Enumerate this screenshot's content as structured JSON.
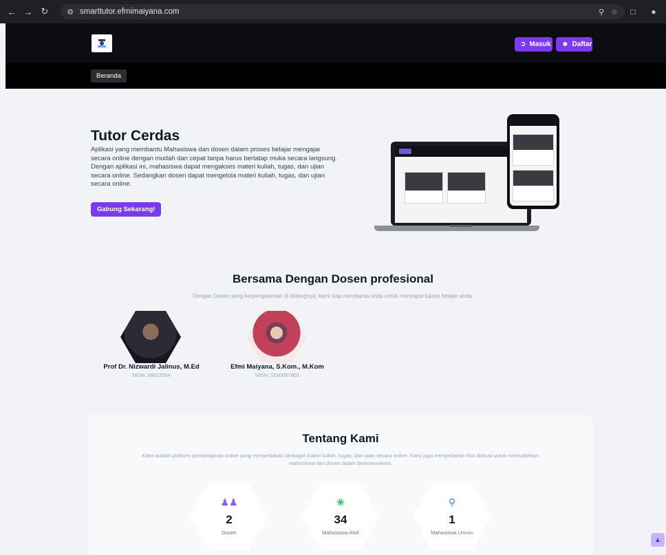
{
  "browser": {
    "url": "smarttutor.efmimaiyana.com",
    "icons": [
      "back-icon",
      "forward-icon",
      "reload-icon",
      "site-info-icon",
      "zoom-icon",
      "bookmark-star-icon",
      "extensions-icon",
      "profile-icon"
    ]
  },
  "header": {
    "login_label": "Masuk",
    "register_label": "Daftar"
  },
  "nav": {
    "items": [
      {
        "label": "Beranda"
      }
    ]
  },
  "hero": {
    "title": "Tutor Cerdas",
    "desc_line1": "Aplikasi yang membantu Mahasiswa dan dosen dalam proses belajar mengajar secara online dengan mudah dan cepat tanpa harus bertatap muka secara langsung.",
    "desc_line2": "Dengan aplikasi ini, mahasiswa dapat mengakses materi kuliah, tugas, dan ujian secara online. Sedangkan dosen dapat mengelola materi kuliah, tugas, dan ujian secara online.",
    "cta_label": "Gabung Sekarang!"
  },
  "dosen_section": {
    "title": "Bersama Dengan Dosen profesional",
    "subtitle": "Dengan Dosen yang berpengalaman di bidangnya, kami siap membantu anda untuk mencapai tujuan belajar anda.",
    "lecturers": [
      {
        "name": "Prof Dr. Nizwardi Jalinus, M.Ed",
        "nidn": "NIDN. 88022004"
      },
      {
        "name": "Efmi Maiyana, S.Kom., M.Kom",
        "nidn": "NIDN. 1030057801"
      }
    ]
  },
  "about": {
    "title": "Tentang Kami",
    "desc": "Kami adalah platform pembelajaran online yang menyediakan berbagai materi kuliah, tugas, dan ujian secara online. Kami juga menyediakan fitur diskusi untuk memudahkan mahasiswa dan dosen dalam berkomunikasi.",
    "stats": [
      {
        "value": "2",
        "label": "Dosen",
        "icon": "users-icon"
      },
      {
        "value": "34",
        "label": "Mahasiswa Aktif",
        "icon": "user-group-icon"
      },
      {
        "value": "1",
        "label": "Mahasiswa Umum",
        "icon": "user-search-icon"
      }
    ]
  },
  "colors": {
    "accent": "#7c3aed",
    "header_bg": "#0c0c12",
    "page_bg": "#f1f3f6"
  }
}
